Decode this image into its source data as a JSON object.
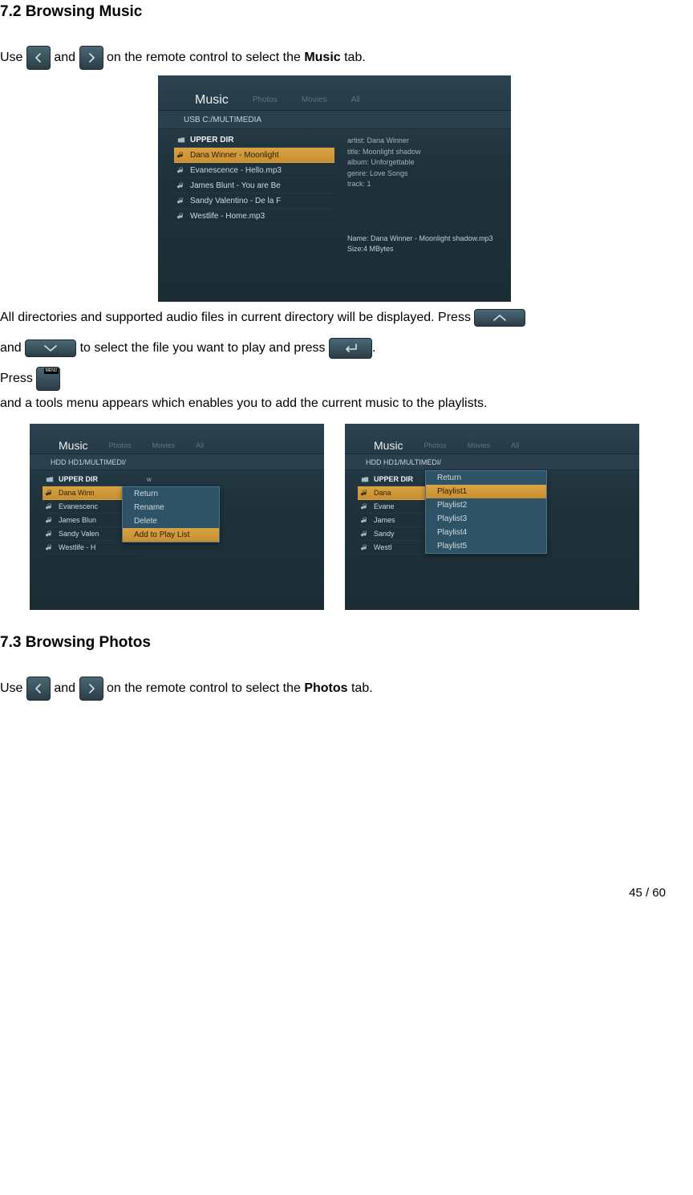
{
  "section_72_title": "7.2 Browsing Music",
  "section_73_title": "7.3 Browsing Photos",
  "p1": {
    "a": "Use ",
    "b": " and ",
    "c": " on the remote control to select the ",
    "tab": "Music",
    "d": " tab."
  },
  "p2": {
    "a": "All directories and supported audio files in current directory will be displayed. Press ",
    "b": "and ",
    "c": " to select the file you want to play and press ",
    "d": "."
  },
  "p3": {
    "a": "Press ",
    "b": " and a tools menu appears which enables you to add the current music to the playlists."
  },
  "p4": {
    "a": "Use ",
    "b": " and ",
    "c": " on the remote control to select the ",
    "tab": "Photos",
    "d": " tab."
  },
  "menu_btn_label": "MENU",
  "shot": {
    "tabs": [
      "Music",
      "Photos",
      "Movies",
      "All"
    ],
    "path_usb": "USB   C:/MULTIMEDIA",
    "path_hdd": "HDD  HD1/MULTIMEDI/",
    "updir": "UPPER DIR",
    "files_full": [
      "Dana Winner - Moonlight",
      "Evanescence - Hello.mp3",
      "James Blunt - You are Be",
      "Sandy Valentino - De la F",
      "Westlife - Home.mp3"
    ],
    "files_trunc": [
      "Dana Winn",
      "Evanescenc",
      "James Blun",
      "Sandy Valen",
      "Westlife - H"
    ],
    "files_trunc2": [
      "Dana",
      "Evane",
      "James",
      "Sandy",
      "Westl"
    ],
    "meta": {
      "artist": "artist: Dana Winner",
      "title": "title: Moonlight shadow",
      "album": "album: Unforgettable",
      "genre": "genre: Love Songs",
      "track": "track: 1",
      "name": "Name: Dana Winner - Moonlight shadow.mp3",
      "size": "Size:4 MBytes"
    },
    "meta_short": {
      "artist_trunc": "w",
      "name_trunc": "Moonlight shadow.mp3",
      "size": "Size:4 MBytes"
    },
    "popup1": [
      "Return",
      "Rename",
      "Delete",
      "Add to Play List"
    ],
    "popup2": [
      "Return",
      "Playlist1",
      "Playlist2",
      "Playlist3",
      "Playlist4",
      "Playlist5"
    ]
  },
  "footer": "45 / 60"
}
